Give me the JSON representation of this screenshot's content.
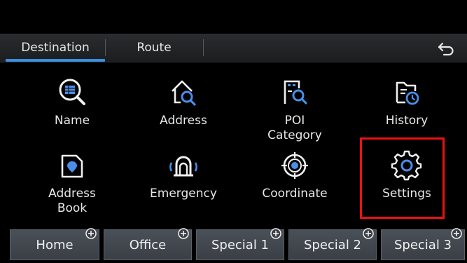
{
  "tabs": {
    "destination": "Destination",
    "route": "Route"
  },
  "menu": {
    "name": "Name",
    "address": "Address",
    "poi_category": "POI\nCategory",
    "history": "History",
    "address_book": "Address\nBook",
    "emergency": "Emergency",
    "coordinate": "Coordinate",
    "settings": "Settings"
  },
  "quick": {
    "home": "Home",
    "office": "Office",
    "special1": "Special 1",
    "special2": "Special 2",
    "special3": "Special 3"
  },
  "colors": {
    "accent": "#3b8fdc",
    "highlight": "#ee1111",
    "background": "#000000"
  }
}
